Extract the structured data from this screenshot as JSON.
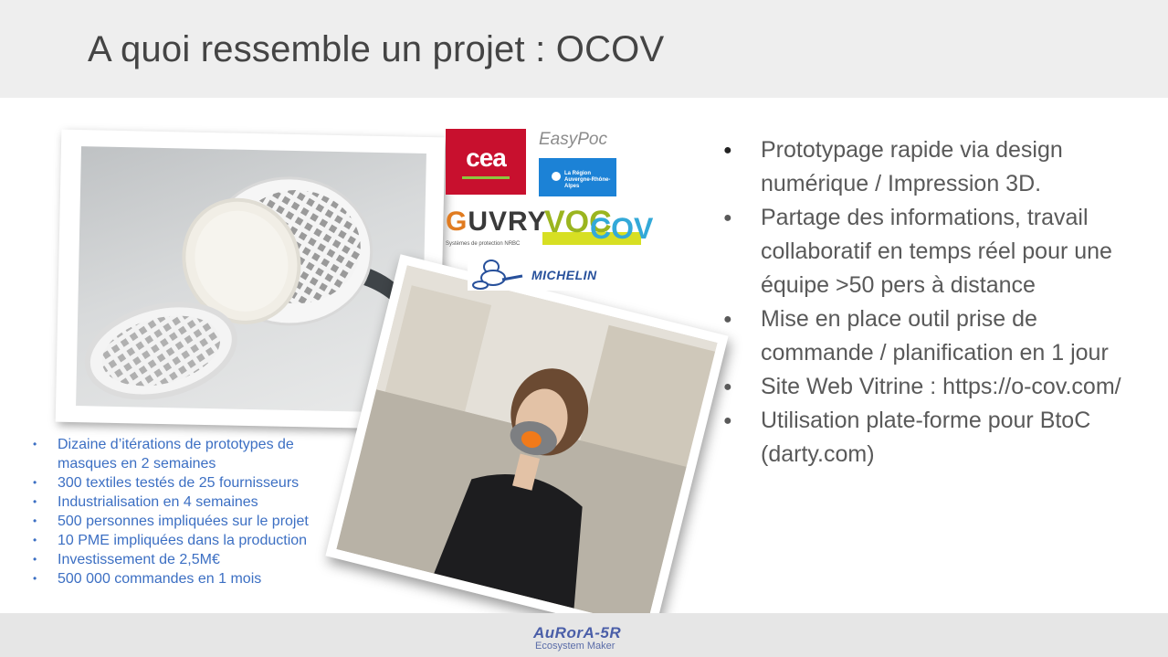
{
  "slide": {
    "title": "A quoi ressemble un projet : OCOV"
  },
  "logos": {
    "cea": "cea",
    "easypoc": "EasyPoc",
    "region_line1": "La Région",
    "region_line2": "Auvergne-Rhône-Alpes",
    "guvry_prefix": "G",
    "guvry_rest": "UVRY",
    "guvry_tagline": "Systèmes de protection NRBC",
    "voc": "VOC",
    "cov": "COV",
    "michelin": "MICHELIN"
  },
  "left_list": [
    "Dizaine d’itérations de prototypes de masques en 2 semaines",
    "300 textiles testés de 25 fournisseurs",
    "Industrialisation en 4 semaines",
    "500 personnes impliquées sur le projet",
    "10 PME impliquées dans la production",
    "Investissement de 2,5M€",
    "500 000 commandes en 1 mois"
  ],
  "right_list": [
    "Prototypage rapide via design numérique / Impression 3D.",
    "Partage des informations, travail collaboratif en temps réel pour une équipe >50 pers à distance",
    "Mise en place outil prise de commande / planification en 1 jour",
    "Site Web Vitrine : https://o-cov.com/",
    "Utilisation plate-forme pour BtoC (darty.com)"
  ],
  "footer": {
    "brand": "AuRorA-5R",
    "subtitle": "Ecosystem Maker"
  }
}
